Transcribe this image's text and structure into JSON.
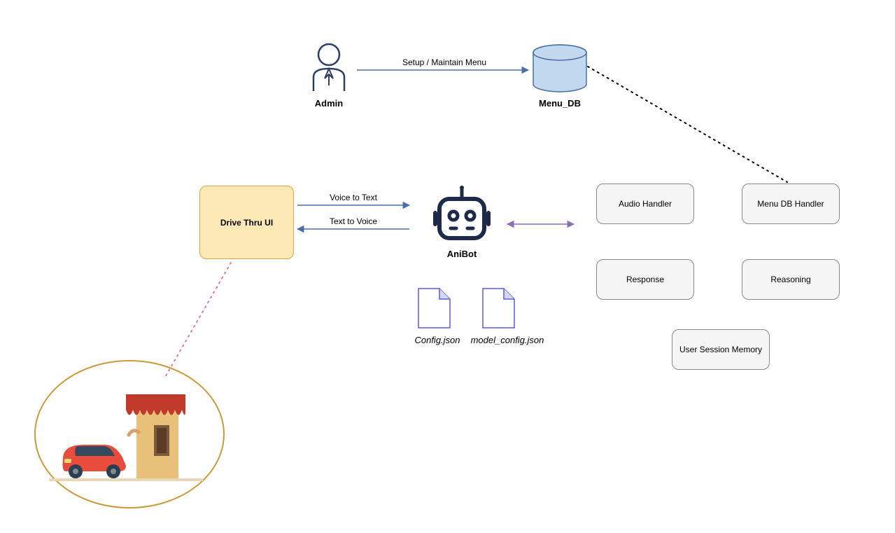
{
  "admin": {
    "label": "Admin"
  },
  "menu_db": {
    "label": "Menu_DB"
  },
  "drive_thru": {
    "label": "Drive Thru UI"
  },
  "anibot": {
    "label": "AniBot"
  },
  "files": {
    "config": "Config.json",
    "model_config": "model_config.json"
  },
  "handlers": {
    "audio": "Audio Handler",
    "menu_db_handler": "Menu DB Handler",
    "response": "Response",
    "reasoning": "Reasoning",
    "session": "User Session Memory"
  },
  "edges": {
    "setup_menu": "Setup / Maintain Menu",
    "voice_to_text": "Voice to Text",
    "text_to_voice": "Text to Voice"
  },
  "colors": {
    "arrow_blue": "#4a6fa5",
    "arrow_purple": "#8a6db5",
    "dotted_black": "#000",
    "dotted_pink": "#d87ca5",
    "file_stroke": "#5b5bd6",
    "db_fill": "#c2d8ef",
    "db_stroke": "#4a6fa5",
    "drive_fill": "#fde9b6",
    "box_fill": "#f5f5f5",
    "bot_stroke": "#1e2a4a",
    "admin_stroke": "#2c3e66"
  }
}
